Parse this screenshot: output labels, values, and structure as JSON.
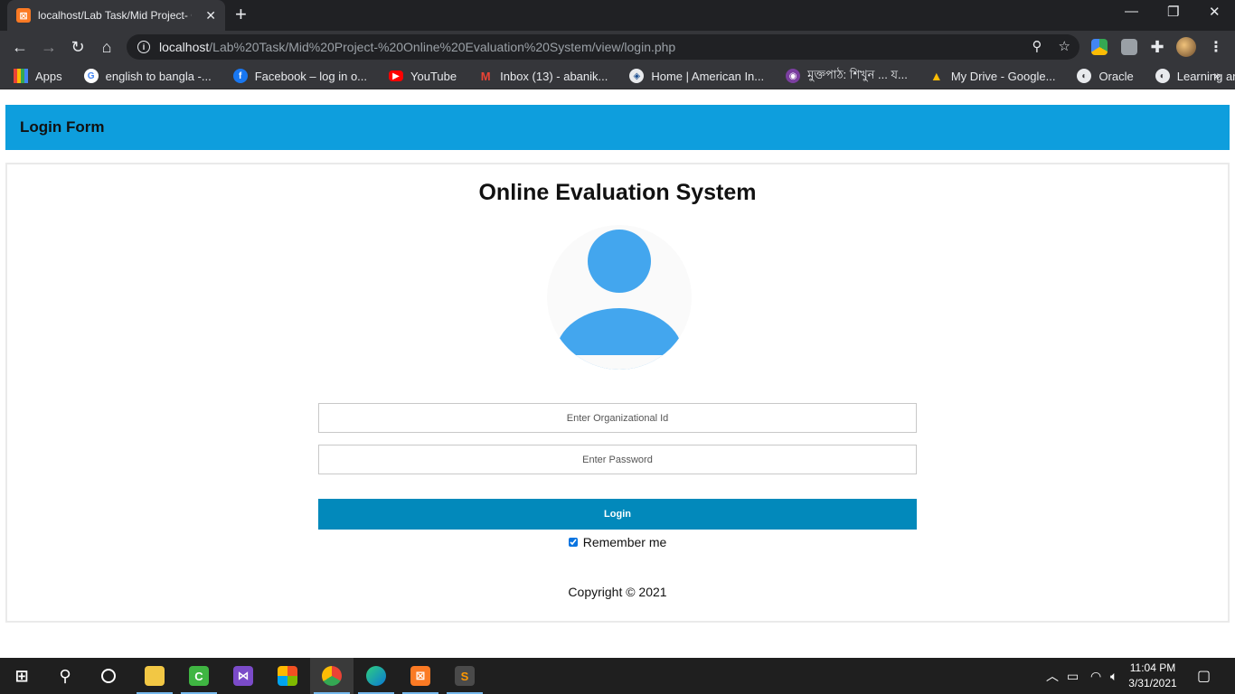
{
  "browser": {
    "tab_title": "localhost/Lab Task/Mid Project- O",
    "tab_favicon": "xampp-icon",
    "url_host": "localhost",
    "url_path": "/Lab%20Task/Mid%20Project-%20Online%20Evaluation%20System/view/login.php",
    "bookmarks": [
      {
        "label": "Apps",
        "icon": "apps-grid-icon"
      },
      {
        "label": "english to bangla -...",
        "icon": "google-icon"
      },
      {
        "label": "Facebook – log in o...",
        "icon": "facebook-icon"
      },
      {
        "label": "YouTube",
        "icon": "youtube-icon"
      },
      {
        "label": "Inbox (13) - abanik...",
        "icon": "gmail-icon"
      },
      {
        "label": "Home | American In...",
        "icon": "aiub-icon"
      },
      {
        "label": "মুক্তপাঠ: শিখুন ... য...",
        "icon": "muktopaath-icon"
      },
      {
        "label": "My Drive - Google...",
        "icon": "google-drive-icon"
      },
      {
        "label": "Oracle",
        "icon": "globe-icon"
      },
      {
        "label": "Learning and Earnin...",
        "icon": "globe-icon"
      }
    ],
    "bookmarks_overflow": "»"
  },
  "page": {
    "header_title": "Login Form",
    "system_title": "Online Evaluation System",
    "org_id_placeholder": "Enter Organizational Id",
    "password_placeholder": "Enter Password",
    "login_label": "Login",
    "remember_label": "Remember me",
    "remember_checked": true,
    "copyright": "Copyright © 2021",
    "colors": {
      "header_bg": "#0e9edd",
      "login_bg": "#0289bb",
      "avatar": "#43a6ee"
    }
  },
  "taskbar": {
    "apps": [
      "windows-start-icon",
      "search-icon",
      "cortana-icon",
      "file-explorer-icon",
      "camtasia-icon",
      "visual-studio-icon",
      "microsoft-store-icon",
      "chrome-icon",
      "edge-icon",
      "xampp-icon",
      "sublime-text-icon"
    ],
    "time": "11:04 PM",
    "date": "3/31/2021"
  }
}
